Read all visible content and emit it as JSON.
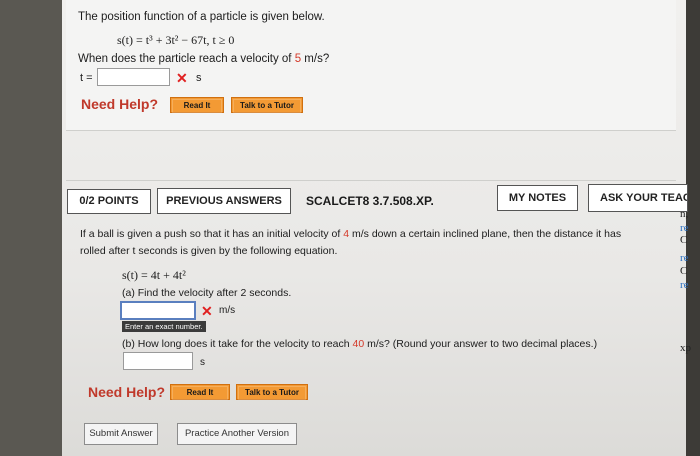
{
  "question1": {
    "prompt": "The position function of a particle is given below.",
    "equation": "s(t) = t³ + 3t² − 67t, t ≥ 0",
    "question_pre": "When does the particle reach a velocity of ",
    "question_value": "5",
    "question_post": " m/s?",
    "answer_label": "t =",
    "answer_value": "",
    "unit": "s",
    "need_help": "Need Help?",
    "read_it": "Read It",
    "talk_to_tutor": "Talk to a Tutor"
  },
  "question2": {
    "points_tab": "0/2 POINTS",
    "previous_answers_tab": "PREVIOUS ANSWERS",
    "problem_code": "SCALCET8 3.7.508.XP.",
    "my_notes": "MY NOTES",
    "ask_teacher": "ASK YOUR TEACH",
    "intro_pre": "If a ball is given a push so that it has an initial velocity of ",
    "intro_value": "4",
    "intro_post": " m/s down a certain inclined plane, then the distance it has",
    "intro_line2": "rolled after t seconds is given by the following equation.",
    "equation": "s(t) = 4t + 4t²",
    "part_a": "(a) Find the velocity after 2 seconds.",
    "part_a_value": "",
    "part_a_unit": "m/s",
    "tooltip": "Enter an exact number.",
    "part_b_pre": "(b) How long does it take for the velocity to reach ",
    "part_b_value": "40",
    "part_b_post": " m/s? (Round your answer to two decimal places.)",
    "part_b_answer": "",
    "part_b_unit": "s",
    "need_help": "Need Help?",
    "read_it": "Read It",
    "talk_to_tutor": "Talk to a Tutor",
    "submit_answer": "Submit Answer",
    "practice_another": "Practice Another Version"
  },
  "side_fragments": [
    "n,",
    "re",
    "C",
    "re",
    "C",
    "re",
    "xp"
  ],
  "colors": {
    "accent_red": "#d43a2a",
    "help_orange": "#f39a34",
    "x_red": "#e02020"
  }
}
